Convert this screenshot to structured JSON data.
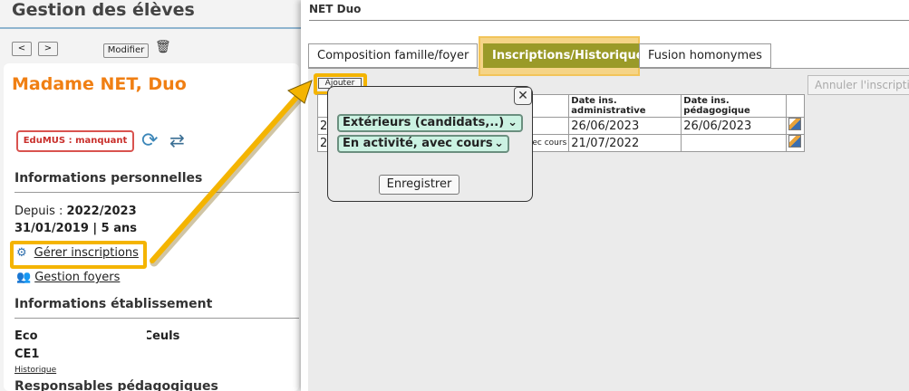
{
  "left_panel": {
    "title": "Gestion des élèves",
    "prev_label": "<",
    "next_label": ">",
    "modify_label": "Modifier",
    "person_name": "Madame  NET, Duo",
    "badge": "EduMUS : manquant",
    "section_personal": "Informations personnelles",
    "since_label": "Depuis : ",
    "since_value": "2022/2023",
    "birth_line": "31/01/2019 | 5 ans",
    "link_manage": "Gérer inscriptions",
    "link_households": "Gestion foyers",
    "section_school": "Informations établissement",
    "school_prefix": "Eco",
    "school_suffix": "Ceuls",
    "class": "CE1",
    "history_link": "Historique",
    "section_resp": "Responsables pédagogiques"
  },
  "right_panel": {
    "title": "NET Duo",
    "tabs": [
      {
        "label": "Composition famille/foyer"
      },
      {
        "label": "Inscriptions/Historique"
      },
      {
        "label": "Fusion homonymes"
      }
    ],
    "add_label": "Ajouter",
    "cancel_label": "Annuler l'inscription",
    "table": {
      "headers": [
        "",
        "",
        "Date ins. administrative",
        "Date ins. pédagogique",
        ""
      ],
      "rows": [
        {
          "c1": "2",
          "c2": "",
          "admin": "26/06/2023",
          "peda": "26/06/2023"
        },
        {
          "c1": "2",
          "c2": "ec cours",
          "admin": "21/07/2022",
          "peda": ""
        }
      ]
    }
  },
  "popup": {
    "close_label": "✕",
    "select_category": "Extérieurs (candidats,..)",
    "select_status": "En activité, avec cours",
    "save_label": "Enregistrer"
  },
  "colors": {
    "accent_orange": "#f07f13",
    "highlight": "#f4b400",
    "active_tab": "#9a9a28",
    "select_bg": "#cbf2e2"
  }
}
